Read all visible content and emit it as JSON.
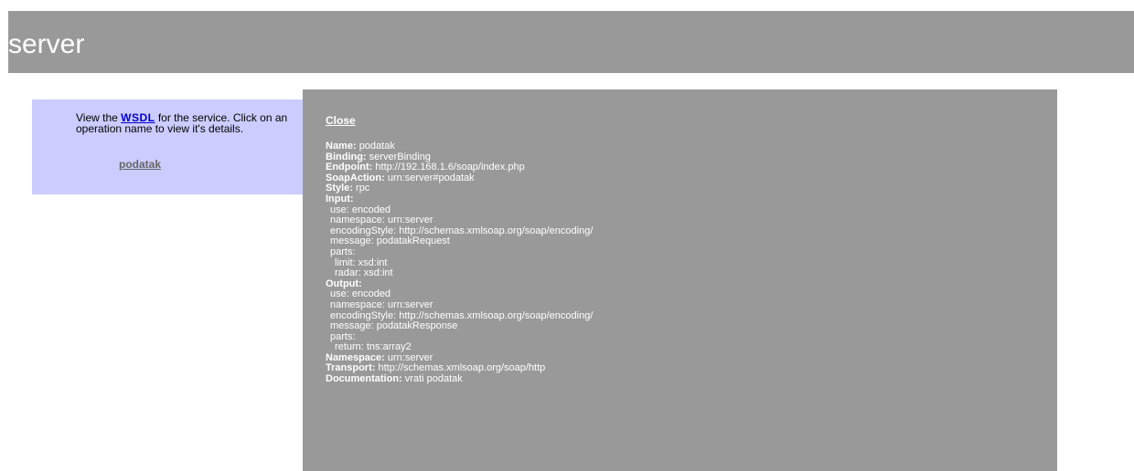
{
  "header": {
    "title": "server"
  },
  "nav": {
    "intro_before": "View the ",
    "wsdl_link": "WSDL",
    "intro_after": " for the service. Click on an operation name to view it's details.",
    "operation": "podatak"
  },
  "details": {
    "close": "Close",
    "name_label": "Name:",
    "name_value": "podatak",
    "binding_label": "Binding:",
    "binding_value": "serverBinding",
    "endpoint_label": "Endpoint:",
    "endpoint_value": "http://192.168.1.6/soap/index.php",
    "soapaction_label": "SoapAction:",
    "soapaction_value": "urn:server#podatak",
    "style_label": "Style:",
    "style_value": "rpc",
    "input_label": "Input:",
    "input": {
      "use": "use: encoded",
      "namespace": "namespace: urn:server",
      "encoding_style": "encodingStyle: http://schemas.xmlsoap.org/soap/encoding/",
      "message": "message: podatakRequest",
      "parts_label": "parts:",
      "parts": [
        "limit: xsd:int",
        "radar: xsd:int"
      ]
    },
    "output_label": "Output:",
    "output": {
      "use": "use: encoded",
      "namespace": "namespace: urn:server",
      "encoding_style": "encodingStyle: http://schemas.xmlsoap.org/soap/encoding/",
      "message": "message: podatakResponse",
      "parts_label": "parts:",
      "parts": [
        "return: tns:array2"
      ]
    },
    "namespace_label": "Namespace:",
    "namespace_value": "urn:server",
    "transport_label": "Transport:",
    "transport_value": "http://schemas.xmlsoap.org/soap/http",
    "documentation_label": "Documentation:",
    "documentation_value": "vrati podatak"
  },
  "colors": {
    "header_bg": "#999999",
    "nav_bg": "#ccccff",
    "details_bg": "#999999",
    "link": "#0000cc"
  }
}
